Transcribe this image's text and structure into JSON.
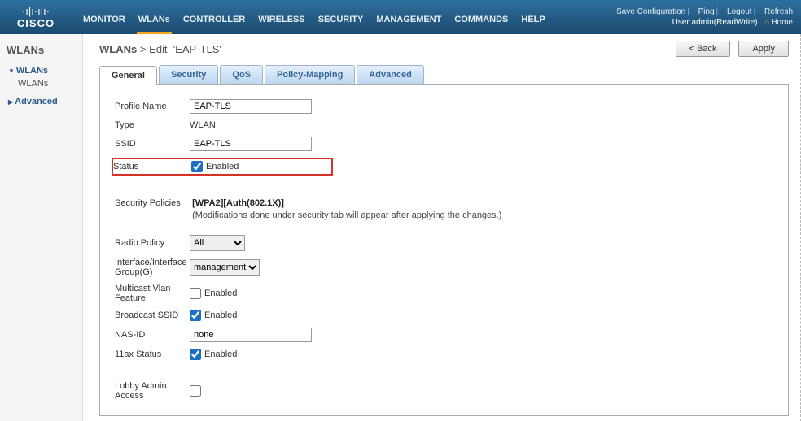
{
  "navbar": {
    "brand": "CISCO",
    "menu": [
      "MONITOR",
      "WLANs",
      "CONTROLLER",
      "WIRELESS",
      "SECURITY",
      "MANAGEMENT",
      "COMMANDS",
      "HELP"
    ],
    "active_menu_index": 1,
    "top_links": {
      "save_config": "Save Configuration",
      "ping": "Ping",
      "logout": "Logout",
      "refresh": "Refresh"
    },
    "user_line_prefix": "User:",
    "user_line_value": "admin(ReadWrite)",
    "home": "Home"
  },
  "sidebar": {
    "title": "WLANs",
    "items": [
      {
        "label": "WLANs",
        "kind": "parent-open"
      },
      {
        "label": "WLANs",
        "kind": "child"
      },
      {
        "label": "Advanced",
        "kind": "parent-closed"
      }
    ]
  },
  "page": {
    "crumb_root": "WLANs",
    "crumb_sep": ">",
    "crumb_action": "Edit",
    "crumb_target": "'EAP-TLS'",
    "btn_back": "< Back",
    "btn_apply": "Apply"
  },
  "tabs": [
    "General",
    "Security",
    "QoS",
    "Policy-Mapping",
    "Advanced"
  ],
  "active_tab_index": 0,
  "form": {
    "profile_name_label": "Profile Name",
    "profile_name_value": "EAP-TLS",
    "type_label": "Type",
    "type_value": "WLAN",
    "ssid_label": "SSID",
    "ssid_value": "EAP-TLS",
    "status_label": "Status",
    "status_checked": true,
    "status_cb_label": "Enabled",
    "security_policies_label": "Security Policies",
    "security_policies_value": "[WPA2][Auth(802.1X)]",
    "security_policies_note": "(Modifications done under security tab will appear after applying the changes.)",
    "radio_policy_label": "Radio Policy",
    "radio_policy_value": "All",
    "interface_group_label": "Interface/Interface Group(G)",
    "interface_group_value": "management",
    "multicast_vlan_label": "Multicast Vlan Feature",
    "multicast_vlan_checked": false,
    "multicast_vlan_cb_label": "Enabled",
    "broadcast_ssid_label": "Broadcast SSID",
    "broadcast_ssid_checked": true,
    "broadcast_ssid_cb_label": "Enabled",
    "nas_id_label": "NAS-ID",
    "nas_id_value": "none",
    "ax_status_label": "11ax Status",
    "ax_status_checked": true,
    "ax_status_cb_label": "Enabled",
    "lobby_admin_label": "Lobby Admin Access",
    "lobby_admin_checked": false
  }
}
